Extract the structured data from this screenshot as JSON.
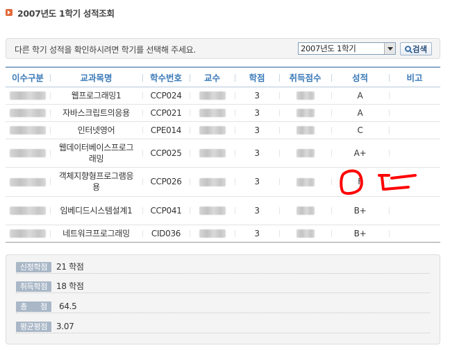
{
  "page": {
    "title": "2007년도 1학기 성적조회"
  },
  "notice": {
    "text": "다른 학기 성적을 확인하시려면 학기를 선택해 주세요.",
    "semester_selected": "2007년도 1학기",
    "search_label": "검색"
  },
  "table": {
    "headers": [
      "이수구분",
      "교과목명",
      "학수번호",
      "교수",
      "학점",
      "취득점수",
      "성적",
      "비고"
    ],
    "rows": [
      {
        "course": "웹프로그래밍1",
        "code": "CCP024",
        "credits": "3",
        "grade": "A"
      },
      {
        "course": "자바스크립트의응용",
        "code": "CCP021",
        "credits": "3",
        "grade": "A"
      },
      {
        "course": "인터넷영어",
        "code": "CPE014",
        "credits": "3",
        "grade": "C"
      },
      {
        "course": "웹데이터베이스프로그래밍",
        "code": "CCP025",
        "credits": "3",
        "grade": "A+"
      },
      {
        "course": "객체지향형프로그램응용",
        "code": "CCP026",
        "credits": "3",
        "grade": "F"
      },
      {
        "course": "임베디드시스템설계1",
        "code": "CCP041",
        "credits": "3",
        "grade": "B+"
      },
      {
        "course": "네트워크프로그래밍",
        "code": "CID036",
        "credits": "3",
        "grade": "B+"
      }
    ]
  },
  "summary": {
    "applied_label": "신청학점",
    "applied_value": "21 학점",
    "earned_label": "취득학점",
    "earned_value": "18 학점",
    "total_label": "총      점",
    "total_value": "64.5",
    "gpa_label": "평균평점",
    "gpa_value": "3.07"
  },
  "colors": {
    "header_text": "#3a7ab8",
    "annotation": "#ff0000",
    "badge_bg": "#a9b7c7"
  }
}
